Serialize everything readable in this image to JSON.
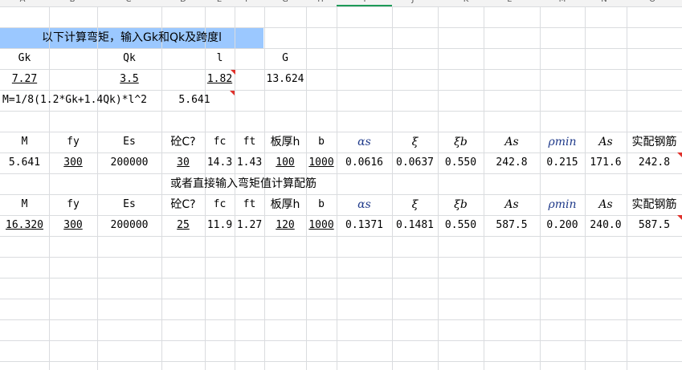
{
  "column_header": {
    "letters": [
      "A",
      "B",
      "C",
      "D",
      "E",
      "F",
      "G",
      "H",
      "I",
      "J",
      "K",
      "L",
      "M",
      "N",
      "O"
    ]
  },
  "banner": {
    "text": "以下计算弯矩，输入Gk和Qk及跨度l"
  },
  "inputs": {
    "labels": {
      "gk": "Gk",
      "qk": "Qk",
      "l": "l",
      "g": "G"
    },
    "values": {
      "gk": "7.27",
      "qk": "3.5",
      "l": "1.82",
      "g": "13.624"
    },
    "formula": "M=1/8(1.2*Gk+1.4Qk)*l^2",
    "formula_result": "5.641"
  },
  "table1": {
    "headers": {
      "m": "M",
      "fy": "fy",
      "es": "Es",
      "concrete": "砼C?",
      "fc": "fc",
      "ft": "ft",
      "thick": "板厚h",
      "b": "b",
      "alpha": "αs",
      "xi": "ξ",
      "xib": "ξb",
      "as1": "As",
      "rho": "ρmin",
      "as2": "As",
      "real": "实配钢筋"
    },
    "values": {
      "m": "5.641",
      "fy": "300",
      "es": "200000",
      "concrete": "30",
      "fc": "14.3",
      "ft": "1.43",
      "thick": "100",
      "b": "1000",
      "alpha": "0.0616",
      "xi": "0.0637",
      "xib": "0.550",
      "as1": "242.8",
      "rho": "0.215",
      "as2": "171.6",
      "real": "242.8"
    }
  },
  "subtitle": "或者直接输入弯矩值计算配筋",
  "table2": {
    "headers": {
      "m": "M",
      "fy": "fy",
      "es": "Es",
      "concrete": "砼C?",
      "fc": "fc",
      "ft": "ft",
      "thick": "板厚h",
      "b": "b",
      "alpha": "αs",
      "xi": "ξ",
      "xib": "ξb",
      "as1": "As",
      "rho": "ρmin",
      "as2": "As",
      "real": "实配钢筋"
    },
    "values": {
      "m": "16.320",
      "fy": "300",
      "es": "200000",
      "concrete": "25",
      "fc": "11.9",
      "ft": "1.27",
      "thick": "120",
      "b": "1000",
      "alpha": "0.1371",
      "xi": "0.1481",
      "xib": "0.550",
      "as1": "587.5",
      "rho": "0.200",
      "as2": "240.0",
      "real": "587.5"
    }
  },
  "colors": {
    "banner": "#9bc8ff",
    "grid": "#dadcdf",
    "comment_flag": "#e0312b",
    "selected_column": "#1e9b58"
  }
}
